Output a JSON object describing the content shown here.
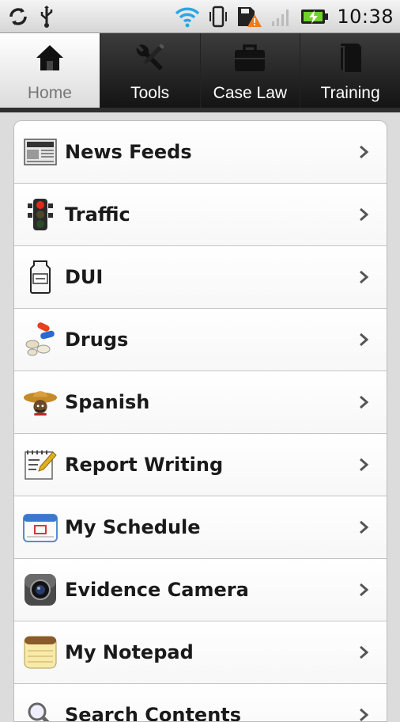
{
  "status_bar": {
    "time": "10:38",
    "icons": [
      "sync-icon",
      "usb-icon",
      "wifi-icon",
      "vibrate-icon",
      "sd-warning-icon",
      "signal-icon",
      "battery-charging-icon"
    ]
  },
  "tabs": [
    {
      "label": "Home",
      "icon": "home-icon",
      "active": true
    },
    {
      "label": "Tools",
      "icon": "tools-icon",
      "active": false
    },
    {
      "label": "Case Law",
      "icon": "briefcase-icon",
      "active": false
    },
    {
      "label": "Training",
      "icon": "book-icon",
      "active": false
    }
  ],
  "menu": [
    {
      "label": "News Feeds",
      "icon": "newspaper-icon"
    },
    {
      "label": "Traffic",
      "icon": "traffic-light-icon"
    },
    {
      "label": "DUI",
      "icon": "liquor-bottle-icon"
    },
    {
      "label": "Drugs",
      "icon": "pills-icon"
    },
    {
      "label": "Spanish",
      "icon": "sombrero-icon"
    },
    {
      "label": "Report Writing",
      "icon": "report-notepad-icon"
    },
    {
      "label": "My Schedule",
      "icon": "calendar-icon"
    },
    {
      "label": "Evidence Camera",
      "icon": "camera-icon"
    },
    {
      "label": "My Notepad",
      "icon": "notepad-icon"
    },
    {
      "label": "Search Contents",
      "icon": "search-icon"
    }
  ]
}
